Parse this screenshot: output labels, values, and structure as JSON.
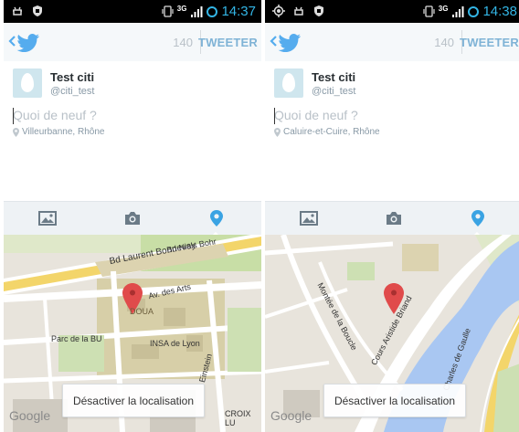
{
  "colors": {
    "twitter_blue": "#55acee",
    "holo_blue": "#33b5e5",
    "pin_red": "#e04b4b",
    "tweeter_text": "#7fb3d6"
  },
  "screens": [
    {
      "status": {
        "network": "3G",
        "time": "14:37"
      },
      "header": {
        "char_count": "140",
        "tweet_button": "TWEETER"
      },
      "user": {
        "name": "Test citi",
        "handle": "@citi_test"
      },
      "compose": {
        "placeholder": "Quoi de neuf ?",
        "location": "Villeurbanne, Rhône"
      },
      "toolbar": {
        "icons": [
          "photo-icon",
          "camera-icon",
          "location-pin-icon"
        ],
        "active": "location-pin-icon"
      },
      "map": {
        "labels": {
          "bd_laurent": "Bd Laurent Bonnevay",
          "bd_niels": "Bd Niels Bohr",
          "av_arts": "Av. des Arts",
          "doua": "DOUA",
          "parc": "Parc de la BU",
          "insa": "INSA de Lyon",
          "einstein": "Einstein",
          "croix": "CROIX LU"
        },
        "google": "Google",
        "disable_button": "Désactiver la localisation"
      }
    },
    {
      "status": {
        "network": "3G",
        "time": "14:38"
      },
      "header": {
        "char_count": "140",
        "tweet_button": "TWEETER"
      },
      "user": {
        "name": "Test citi",
        "handle": "@citi_test"
      },
      "compose": {
        "placeholder": "Quoi de neuf ?",
        "location": "Caluire-et-Cuire, Rhône"
      },
      "toolbar": {
        "icons": [
          "photo-icon",
          "camera-icon",
          "location-pin-icon"
        ],
        "active": "location-pin-icon"
      },
      "map": {
        "labels": {
          "montee": "Montée de la Boucle",
          "cours": "Cours Aristide Briand",
          "charles": "Charles de Gaulle"
        },
        "google": "Google",
        "disable_button": "Désactiver la localisation"
      }
    }
  ]
}
